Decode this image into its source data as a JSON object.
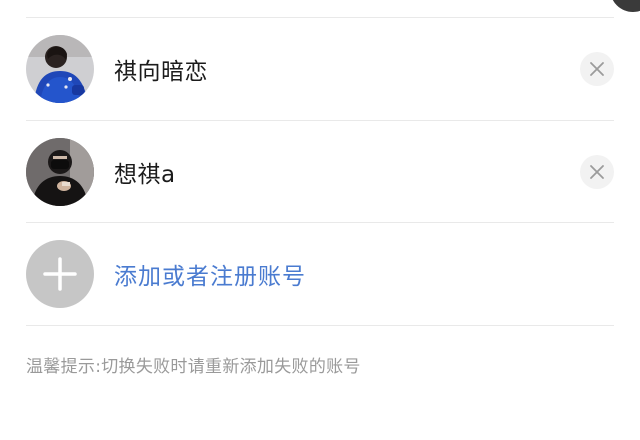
{
  "accounts": [
    {
      "name": "祺向暗恋",
      "avatar_icon": "avatar-blue-jacket",
      "remove_icon": "close-icon"
    },
    {
      "name": "想祺a",
      "avatar_icon": "avatar-black-mask",
      "remove_icon": "close-icon"
    }
  ],
  "add_account": {
    "icon": "plus-icon",
    "label": "添加或者注册账号"
  },
  "hint": "温馨提示:切换失败时请重新添加失败的账号",
  "colors": {
    "link": "#4a7bd0",
    "hint": "#9a9a9a",
    "divider": "#e9e9e9",
    "add_circle": "#c6c6c6"
  }
}
